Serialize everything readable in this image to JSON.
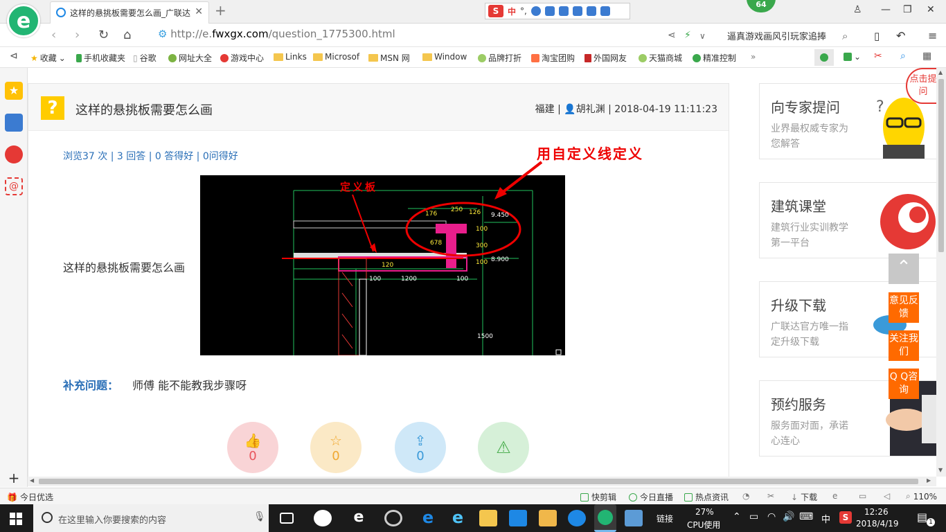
{
  "browser": {
    "tab_title": "这样的悬挑板需要怎么画_广联达",
    "tab_close": "✕",
    "new_tab": "+",
    "ime": {
      "s": "S",
      "lang": "中",
      "punct": "°,"
    },
    "badge": "64",
    "url_prefix": "http://e.",
    "url_host": "fwxgx.com",
    "url_path": "/question_1775300.html",
    "search_text": "逼真游戏画风引玩家追捧"
  },
  "bookmarks": [
    {
      "label": "收藏",
      "icon": "star-icon"
    },
    {
      "label": "手机收藏夹",
      "icon": "phone-icon"
    },
    {
      "label": "谷歌",
      "icon": "page-icon"
    },
    {
      "label": "网址大全",
      "icon": "globe-icon"
    },
    {
      "label": "游戏中心",
      "icon": "game-icon"
    },
    {
      "label": "Links",
      "icon": "folder-icon"
    },
    {
      "label": "Microsof",
      "icon": "folder-icon"
    },
    {
      "label": "MSN 网",
      "icon": "folder-icon"
    },
    {
      "label": "Window",
      "icon": "folder-icon"
    },
    {
      "label": "品牌打折",
      "icon": "leaf-icon"
    },
    {
      "label": "淘宝团购",
      "icon": "taobao-icon"
    },
    {
      "label": "外国网友",
      "icon": "flag-icon"
    },
    {
      "label": "天猫商城",
      "icon": "leaf-icon"
    },
    {
      "label": "精准控制",
      "icon": "wechat-icon"
    }
  ],
  "question": {
    "title": "这样的悬挑板需要怎么画",
    "region": "福建",
    "author": "胡礼渊",
    "datetime": "2018-04-19 11:11:23",
    "stats": "浏览37 次 | 3 回答 | 0 答得好 | 0问得好",
    "body": "这样的悬挑板需要怎么画",
    "supp_label": "补充问题：",
    "supp_text": "师傅  能不能教我步骤呀",
    "annotation_right": "用自定义线定义",
    "annotation_left": "定义板",
    "cad_labels": [
      "176",
      "250",
      "126",
      "9.450",
      "100",
      "300",
      "100",
      "8.900",
      "120",
      "100",
      "1200",
      "100",
      "1500",
      "678"
    ],
    "actions": [
      {
        "name": "like",
        "icon": "👍",
        "count": "0",
        "bg": "#f9d4d6",
        "fg": "#e8545c"
      },
      {
        "name": "favorite",
        "icon": "☆",
        "count": "0",
        "bg": "#fbe9c6",
        "fg": "#f0a830"
      },
      {
        "name": "share",
        "icon": "⇪",
        "count": "0",
        "bg": "#cfe8f8",
        "fg": "#3a9ad9"
      },
      {
        "name": "report",
        "icon": "⚠",
        "count": "",
        "bg": "#d6f0d8",
        "fg": "#4caf50"
      }
    ]
  },
  "right_cards": [
    {
      "title": "向专家提问",
      "sub": "业界最权威专家为您解答"
    },
    {
      "title": "建筑课堂",
      "sub": "建筑行业实训教学第一平台"
    },
    {
      "title": "升级下载",
      "sub": "广联达官方唯一指定升级下载"
    },
    {
      "title": "预约服务",
      "sub": "服务面对面，承诺心连心"
    }
  ],
  "float_buttons": [
    "意见反馈",
    "关注我们",
    "Q Q咨询"
  ],
  "corner_bubble": "点击提问",
  "status_bar": {
    "left": "今日优选",
    "items": [
      "快剪辑",
      "今日直播",
      "热点资讯",
      "下载"
    ],
    "zoom": "110%"
  },
  "taskbar": {
    "search_placeholder": "在这里输入你要搜索的内容",
    "link": "链接",
    "cpu_pct": "27%",
    "cpu_label": "CPU使用",
    "ime": "中",
    "time": "12:26",
    "date": "2018/4/19",
    "notif": "1"
  },
  "colors": {
    "accent": "#2a6fb7",
    "orange": "#ff6a00",
    "green": "#22b573"
  }
}
